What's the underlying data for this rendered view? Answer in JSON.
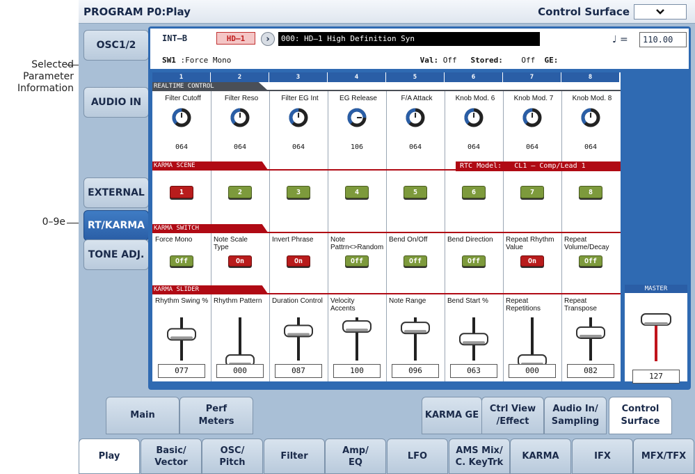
{
  "annotations": {
    "selected_param_info": "Selected\nParameter\nInformation",
    "tab_marker": "0–9e"
  },
  "titlebar": {
    "title": "PROGRAM P0:Play",
    "page": "Control Surface"
  },
  "side_tabs": [
    "OSC1/2",
    "AUDIO IN",
    "EXTERNAL",
    "RT/KARMA",
    "TONE ADJ."
  ],
  "info": {
    "bank": "INT–B",
    "badge": "HD–1",
    "program": "000: HD–1 High Definition Syn",
    "tempo_symbol": "♩ =",
    "tempo": "110.00",
    "sw_label": "SW1",
    "sw_value": ":Force Mono",
    "val_label": "Val:",
    "val_value": "Off",
    "stored_label": "Stored:",
    "stored_value": "Off",
    "ge_label": "GE:"
  },
  "columns": [
    "1",
    "2",
    "3",
    "4",
    "5",
    "6",
    "7",
    "8"
  ],
  "realtime": {
    "section_label": "REALTIME CONTROL",
    "knobs": [
      {
        "label": "Filter Cutoff",
        "value": "064"
      },
      {
        "label": "Filter Reso",
        "value": "064"
      },
      {
        "label": "Filter EG Int",
        "value": "064"
      },
      {
        "label": "EG Release",
        "value": "106"
      },
      {
        "label": "F/A Attack",
        "value": "064"
      },
      {
        "label": "Knob Mod. 6",
        "value": "064"
      },
      {
        "label": "Knob Mod. 7",
        "value": "064"
      },
      {
        "label": "Knob Mod. 8",
        "value": "064"
      }
    ]
  },
  "scene": {
    "section_label": "KARMA SCENE",
    "rtc_label": "RTC Model:",
    "rtc_value": "CL1 – Comp/Lead 1",
    "buttons": [
      {
        "label": "1",
        "on": true
      },
      {
        "label": "2",
        "on": false
      },
      {
        "label": "3",
        "on": false
      },
      {
        "label": "4",
        "on": false
      },
      {
        "label": "5",
        "on": false
      },
      {
        "label": "6",
        "on": false
      },
      {
        "label": "7",
        "on": false
      },
      {
        "label": "8",
        "on": false
      }
    ]
  },
  "switches": {
    "section_label": "KARMA SWITCH",
    "items": [
      {
        "label": "Force Mono",
        "state": "Off"
      },
      {
        "label": "Note Scale\nType",
        "state": "On"
      },
      {
        "label": "Invert Phrase",
        "state": "On"
      },
      {
        "label": "Note\nPattrn<>Random",
        "state": "Off"
      },
      {
        "label": "Bend On/Off",
        "state": "Off"
      },
      {
        "label": "Bend Direction",
        "state": "Off"
      },
      {
        "label": "Repeat Rhythm\nValue",
        "state": "On"
      },
      {
        "label": "Repeat\nVolume/Decay",
        "state": "Off"
      }
    ]
  },
  "sliders": {
    "section_label": "KARMA SLIDER",
    "items": [
      {
        "label": "Rhythm Swing %",
        "value": "077"
      },
      {
        "label": "Rhythm Pattern",
        "value": "000"
      },
      {
        "label": "Duration Control",
        "value": "087"
      },
      {
        "label": "Velocity\nAccents",
        "value": "100"
      },
      {
        "label": "Note Range",
        "value": "096"
      },
      {
        "label": "Bend Start %",
        "value": "063"
      },
      {
        "label": "Repeat\nRepetitions",
        "value": "000"
      },
      {
        "label": "Repeat\nTranspose",
        "value": "082"
      }
    ]
  },
  "master": {
    "label": "MASTER",
    "value": "127"
  },
  "sub_tabs": [
    {
      "label": "Main",
      "active": false
    },
    {
      "label": "Perf\nMeters",
      "active": false
    },
    {
      "label": "KARMA GE",
      "active": false
    },
    {
      "label": "Ctrl View\n/Effect",
      "active": false
    },
    {
      "label": "Audio In/\nSampling",
      "active": false
    },
    {
      "label": "Control\nSurface",
      "active": true
    }
  ],
  "page_tabs": [
    {
      "label": "Play",
      "active": true
    },
    {
      "label": "Basic/\nVector",
      "active": false
    },
    {
      "label": "OSC/\nPitch",
      "active": false
    },
    {
      "label": "Filter",
      "active": false
    },
    {
      "label": "Amp/\nEQ",
      "active": false
    },
    {
      "label": "LFO",
      "active": false
    },
    {
      "label": "AMS Mix/\nC. KeyTrk",
      "active": false
    },
    {
      "label": "KARMA",
      "active": false
    },
    {
      "label": "IFX",
      "active": false
    },
    {
      "label": "MFX/TFX",
      "active": false
    }
  ]
}
